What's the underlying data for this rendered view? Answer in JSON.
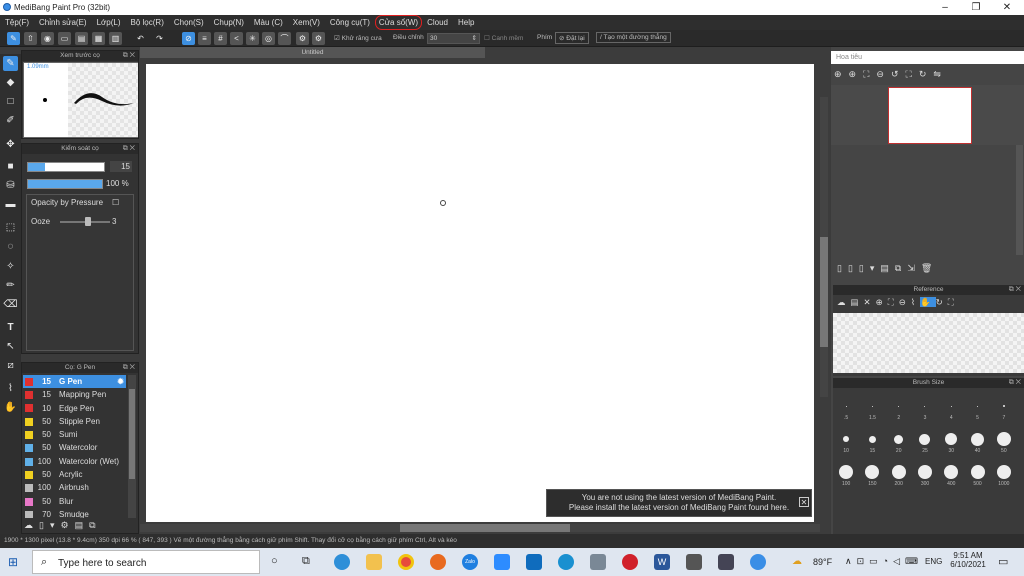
{
  "window": {
    "title": "MediBang Paint Pro (32bit)",
    "min": "–",
    "max": "❐",
    "close": "✕"
  },
  "menu": [
    "Tệp(F)",
    "Chỉnh sửa(E)",
    "Lớp(L)",
    "Bộ lọc(R)",
    "Chọn(S)",
    "Chụp(N)",
    "Màu (C)",
    "Xem(V)",
    "Công cụ(T)",
    "Cửa sổ(W)",
    "Cloud",
    "Help"
  ],
  "toolbar": {
    "antialias": "Khử răng cưa",
    "adjust_label": "Điều chỉnh",
    "adjust_value": "30",
    "correction": "Canh mềm",
    "key_label": "Phím",
    "reset": "Đặt lại",
    "straight": "Tạo một đường thẳng"
  },
  "brush_preview": {
    "title": "Xem trước cọ",
    "size": "1.09mm"
  },
  "brush_control": {
    "title": "Kiểm soát cọ",
    "size": "15",
    "opacity": "100 %",
    "size_fill": 0.23,
    "opacity_fill": 1.0,
    "opacity_pressure": "Opacity by Pressure",
    "ooze_label": "Ooze",
    "ooze_value": "3"
  },
  "brush_list": {
    "title": "Cọ: G Pen",
    "items": [
      {
        "size": "15",
        "name": "G Pen",
        "color": "#e03030",
        "selected": true
      },
      {
        "size": "15",
        "name": "Mapping Pen",
        "color": "#e03030"
      },
      {
        "size": "10",
        "name": "Edge Pen",
        "color": "#e03030"
      },
      {
        "size": "50",
        "name": "Stipple Pen",
        "color": "#f0d020"
      },
      {
        "size": "50",
        "name": "Sumi",
        "color": "#f0d020"
      },
      {
        "size": "50",
        "name": "Watercolor",
        "color": "#60b0e8"
      },
      {
        "size": "100",
        "name": "Watercolor (Wet)",
        "color": "#60b0e8"
      },
      {
        "size": "50",
        "name": "Acrylic",
        "color": "#f0d020"
      },
      {
        "size": "100",
        "name": "Airbrush",
        "color": "#bbbbbb"
      },
      {
        "size": "50",
        "name": "Blur",
        "color": "#e878c8"
      },
      {
        "size": "70",
        "name": "Smudge",
        "color": "#bbbbbb"
      }
    ]
  },
  "canvas": {
    "tab": "Untitled"
  },
  "navigator": {
    "title": "Hoa tiêu"
  },
  "reference": {
    "title": "Reference"
  },
  "brush_size": {
    "title": "Brush Size",
    "row1": [
      ".5",
      "1.5",
      "2",
      "3",
      "4",
      "5",
      "7"
    ],
    "row2": [
      "10",
      "15",
      "20",
      "25",
      "30",
      "40",
      "50"
    ],
    "row3": [
      "100",
      "150",
      "200",
      "300",
      "400",
      "500",
      "1000"
    ]
  },
  "notice": {
    "line1": "You are not using the latest version of MediBang Paint.",
    "line2": "Please install the latest version of MediBang Paint found here."
  },
  "status": {
    "text": "1900 * 1300 pixel   (13.8 * 9.4cm)   350 dpi   66 %   ( 847, 393 )   Vẽ một đường thẳng bằng cách giữ phím Shift. Thay đổi cỡ cọ bằng cách giữ phím Ctrl, Alt và kéo"
  },
  "taskbar": {
    "search": "Type here to search",
    "temp": "89°F",
    "lang": "ENG",
    "time": "9:51 AM",
    "date": "6/10/2021"
  }
}
